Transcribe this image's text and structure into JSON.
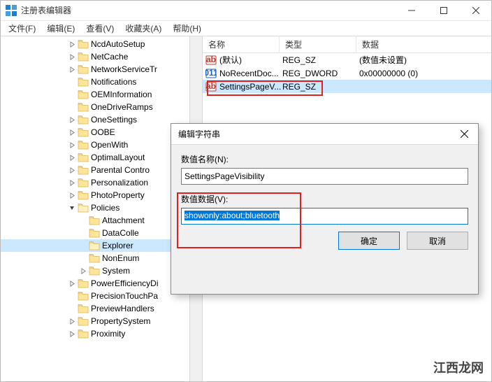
{
  "window": {
    "title": "注册表编辑器"
  },
  "menu": {
    "file": "文件(F)",
    "edit": "编辑(E)",
    "view": "查看(V)",
    "fav": "收藏夹(A)",
    "help": "帮助(H)"
  },
  "tree": [
    {
      "indent": 6,
      "exp": "closed",
      "label": "NcdAutoSetup"
    },
    {
      "indent": 6,
      "exp": "closed",
      "label": "NetCache"
    },
    {
      "indent": 6,
      "exp": "closed",
      "label": "NetworkServiceTr"
    },
    {
      "indent": 6,
      "exp": "none",
      "label": "Notifications"
    },
    {
      "indent": 6,
      "exp": "none",
      "label": "OEMInformation"
    },
    {
      "indent": 6,
      "exp": "none",
      "label": "OneDriveRamps"
    },
    {
      "indent": 6,
      "exp": "closed",
      "label": "OneSettings"
    },
    {
      "indent": 6,
      "exp": "closed",
      "label": "OOBE"
    },
    {
      "indent": 6,
      "exp": "closed",
      "label": "OpenWith"
    },
    {
      "indent": 6,
      "exp": "closed",
      "label": "OptimalLayout"
    },
    {
      "indent": 6,
      "exp": "closed",
      "label": "Parental Contro"
    },
    {
      "indent": 6,
      "exp": "closed",
      "label": "Personalization"
    },
    {
      "indent": 6,
      "exp": "closed",
      "label": "PhotoProperty"
    },
    {
      "indent": 6,
      "exp": "open",
      "label": "Policies"
    },
    {
      "indent": 7,
      "exp": "none",
      "label": "Attachment"
    },
    {
      "indent": 7,
      "exp": "none",
      "label": "DataColle"
    },
    {
      "indent": 7,
      "exp": "none",
      "label": "Explorer",
      "selected": true
    },
    {
      "indent": 7,
      "exp": "none",
      "label": "NonEnum"
    },
    {
      "indent": 7,
      "exp": "closed",
      "label": "System"
    },
    {
      "indent": 6,
      "exp": "closed",
      "label": "PowerEfficiencyDi"
    },
    {
      "indent": 6,
      "exp": "none",
      "label": "PrecisionTouchPa"
    },
    {
      "indent": 6,
      "exp": "none",
      "label": "PreviewHandlers"
    },
    {
      "indent": 6,
      "exp": "closed",
      "label": "PropertySystem"
    },
    {
      "indent": 6,
      "exp": "closed",
      "label": "Proximity"
    }
  ],
  "columns": {
    "name": "名称",
    "type": "类型",
    "data": "数据"
  },
  "values": [
    {
      "icon": "ab",
      "name": "(默认)",
      "type": "REG_SZ",
      "data": "(数值未设置)"
    },
    {
      "icon": "bin",
      "name": "NoRecentDoc...",
      "type": "REG_DWORD",
      "data": "0x00000000 (0)"
    },
    {
      "icon": "ab",
      "name": "SettingsPageV...",
      "type": "REG_SZ",
      "data": "",
      "hl": true
    }
  ],
  "dialog": {
    "title": "编辑字符串",
    "name_label": "数值名称(N):",
    "name_value": "SettingsPageVisibility",
    "data_label": "数值数据(V):",
    "data_value": "showonly:about;bluetooth",
    "ok": "确定",
    "cancel": "取消"
  },
  "watermark": "江西龙网"
}
